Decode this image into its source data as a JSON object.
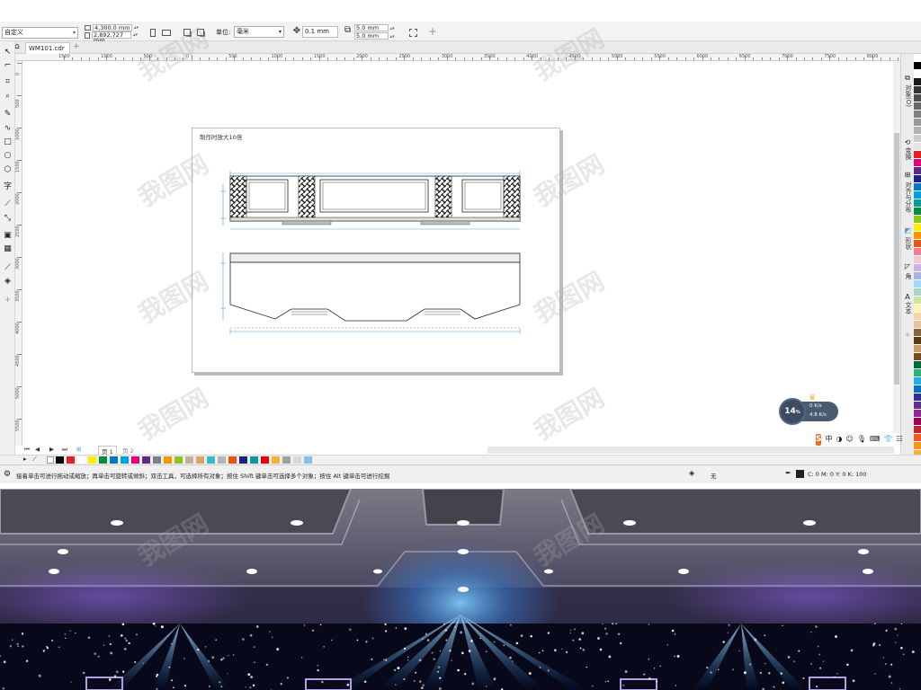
{
  "property_bar": {
    "preset_label": "自定义",
    "width_value": "4,300.0 mm",
    "height_value": "2,892.727 mm",
    "units_label": "单位:",
    "units_value": "毫米",
    "nudge_value": "0.1 mm",
    "dup_x": "5.0 mm",
    "dup_y": "5.0 mm"
  },
  "tabs": {
    "doc_tab": "WM101.cdr"
  },
  "ruler": {
    "h_labels": [
      "1500",
      "1000",
      "500",
      "0",
      "500",
      "1000",
      "1500",
      "2000",
      "2500",
      "3000",
      "3500",
      "4000",
      "4500",
      "5000",
      "5500",
      "6000",
      "6500",
      "7000",
      "7500",
      "8000"
    ],
    "v_labels": [
      "0",
      "500",
      "1000",
      "1500",
      "2000",
      "2500",
      "3000",
      "3500",
      "4000",
      "4500",
      "5000",
      "5500"
    ]
  },
  "page": {
    "note": "制作时放大10倍"
  },
  "docker": {
    "tabs": [
      "对象(O)",
      "变换",
      "对齐与分布",
      "形状",
      "角",
      "文本"
    ]
  },
  "page_nav": {
    "page1": "页 1",
    "page2": "页 2"
  },
  "status": {
    "hint": "接着单击可进行拖动或缩放；再单击可旋转或倾斜；双击工具，可选择所有对象；按住 Shift 键单击可选择多个对象；按住 Alt 键单击可进行挖掘",
    "fill_text": "无",
    "outline_cmyk": "C: 0 M: 0 Y: 0 K: 100"
  },
  "net_monitor": {
    "percent": "14",
    "percent_unit": "%",
    "up_speed": "0 K/s",
    "down_speed": "4.8 K/s"
  },
  "ime": {
    "logo": "S",
    "mode": "中"
  },
  "watermark": {
    "text": "我图网"
  },
  "colors": {
    "palette": [
      "#000000",
      "#e51f26",
      "#ffffff",
      "#ffed00",
      "#008f39",
      "#0079c1",
      "#00a0e3",
      "#e4007f",
      "#5a2d82",
      "#7f7f7f",
      "#f39800",
      "#8fc31f",
      "#c6b198",
      "#d4a76a",
      "#3cb6c8",
      "#b5b5b6",
      "#ea5514",
      "#1d2088",
      "#009e96",
      "#e60012",
      "#f7b52c",
      "#a0a0a0",
      "#d9d9d9",
      "#84c1e8"
    ],
    "right_palette": [
      "#ffffff",
      "#000000",
      "#ffffff",
      "#1a1a1a",
      "#333333",
      "#4d4d4d",
      "#666666",
      "#808080",
      "#999999",
      "#b3b3b3",
      "#cccccc",
      "#e6e6e6",
      "#e51f26",
      "#e4007f",
      "#5a2d82",
      "#1d2088",
      "#0079c1",
      "#00a0e3",
      "#009e96",
      "#008f39",
      "#8fc31f",
      "#ffed00",
      "#f39800",
      "#ea5514",
      "#ee7f8e",
      "#f7c6d6",
      "#c9b5e0",
      "#a1b5dd",
      "#9fd9f6",
      "#a2d7c6",
      "#cde4a4",
      "#fff6a5",
      "#fbd3a0",
      "#e4c3a3",
      "#8c6239",
      "#603813",
      "#c69c6d",
      "#754c24",
      "#006837",
      "#22b573",
      "#29abe2",
      "#0071bc",
      "#2e3192",
      "#662d91",
      "#93278f",
      "#9e005d",
      "#c1272d",
      "#f15a24",
      "#f7931e",
      "#fbb03b",
      "#d9e021",
      "#8cc63f"
    ],
    "accent": "#4e9fd8"
  }
}
